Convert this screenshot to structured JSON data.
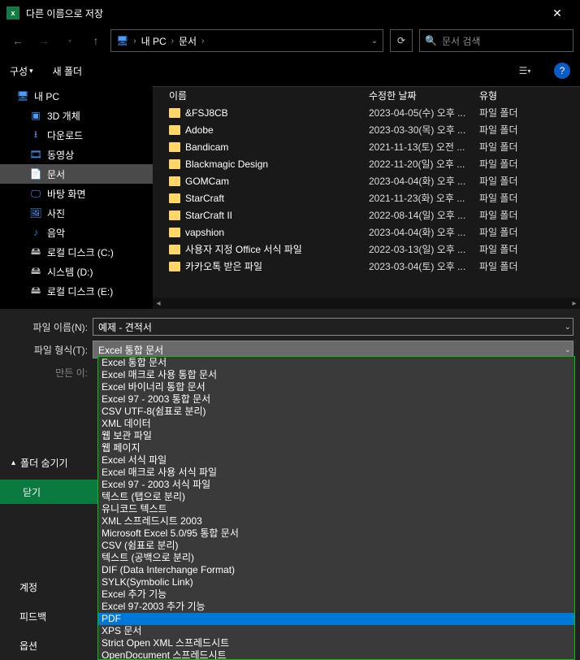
{
  "title": "다른 이름으로 저장",
  "breadcrumbs": [
    "내 PC",
    "문서"
  ],
  "search_placeholder": "문서 검색",
  "toolbar": {
    "organize": "구성",
    "newfolder": "새 폴더",
    "caret": "▾"
  },
  "sidebar": [
    {
      "label": "내 PC",
      "icon": "🖥"
    },
    {
      "label": "3D 개체",
      "icon": "▣"
    },
    {
      "label": "다운로드",
      "icon": "⭳"
    },
    {
      "label": "동영상",
      "icon": "🎞"
    },
    {
      "label": "문서",
      "icon": "📄",
      "sel": true
    },
    {
      "label": "바탕 화면",
      "icon": "🖵"
    },
    {
      "label": "사진",
      "icon": "🖼"
    },
    {
      "label": "음악",
      "icon": "♪"
    },
    {
      "label": "로컬 디스크 (C:)",
      "icon": "🖴"
    },
    {
      "label": "시스템 (D:)",
      "icon": "🖴"
    },
    {
      "label": "로컬 디스크 (E:)",
      "icon": "🖴"
    }
  ],
  "columns": {
    "name": "이름",
    "date": "수정한 날짜",
    "type": "유형"
  },
  "files": [
    {
      "name": "&FSJ8CB",
      "date": "2023-04-05(수) 오후 ...",
      "type": "파일 폴더"
    },
    {
      "name": "Adobe",
      "date": "2023-03-30(목) 오후 ...",
      "type": "파일 폴더"
    },
    {
      "name": "Bandicam",
      "date": "2021-11-13(토) 오전 ...",
      "type": "파일 폴더"
    },
    {
      "name": "Blackmagic Design",
      "date": "2022-11-20(일) 오후 ...",
      "type": "파일 폴더"
    },
    {
      "name": "GOMCam",
      "date": "2023-04-04(화) 오후 ...",
      "type": "파일 폴더"
    },
    {
      "name": "StarCraft",
      "date": "2021-11-23(화) 오후 ...",
      "type": "파일 폴더"
    },
    {
      "name": "StarCraft II",
      "date": "2022-08-14(일) 오후 ...",
      "type": "파일 폴더"
    },
    {
      "name": "vapshion",
      "date": "2023-04-04(화) 오후 ...",
      "type": "파일 폴더"
    },
    {
      "name": "사용자 지정 Office 서식 파일",
      "date": "2022-03-13(일) 오후 ...",
      "type": "파일 폴더"
    },
    {
      "name": "카카오톡 받은 파일",
      "date": "2023-03-04(토) 오후 ...",
      "type": "파일 폴더"
    }
  ],
  "filename_label": "파일 이름(N):",
  "filename_value": "예제 - 견적서",
  "filetype_label": "파일 형식(T):",
  "filetype_value": "Excel 통합 문서",
  "author_label": "만든 이:",
  "hide_folders": "폴더 숨기기",
  "close_btn": "닫기",
  "account": "계정",
  "feedback": "피드백",
  "options_label": "옵션",
  "format_options": [
    "Excel 통합 문서",
    "Excel 매크로 사용 통합 문서",
    "Excel 바이너리 통합 문서",
    "Excel 97 - 2003 통합 문서",
    "CSV UTF-8(쉼표로 분리)",
    "XML 데이터",
    "웹 보관 파일",
    "웹 페이지",
    "Excel 서식 파일",
    "Excel 매크로 사용 서식 파일",
    "Excel 97 - 2003 서식 파일",
    "텍스트 (탭으로 분리)",
    "유니코드 텍스트",
    "XML 스프레드시트 2003",
    "Microsoft Excel 5.0/95 통합 문서",
    "CSV (쉼표로 분리)",
    "텍스트 (공백으로 분리)",
    "DIF (Data Interchange Format)",
    "SYLK(Symbolic Link)",
    "Excel 추가 기능",
    "Excel 97-2003 추가 기능",
    "PDF",
    "XPS 문서",
    "Strict Open XML 스프레드시트",
    "OpenDocument 스프레드시트"
  ],
  "format_highlight": 21
}
